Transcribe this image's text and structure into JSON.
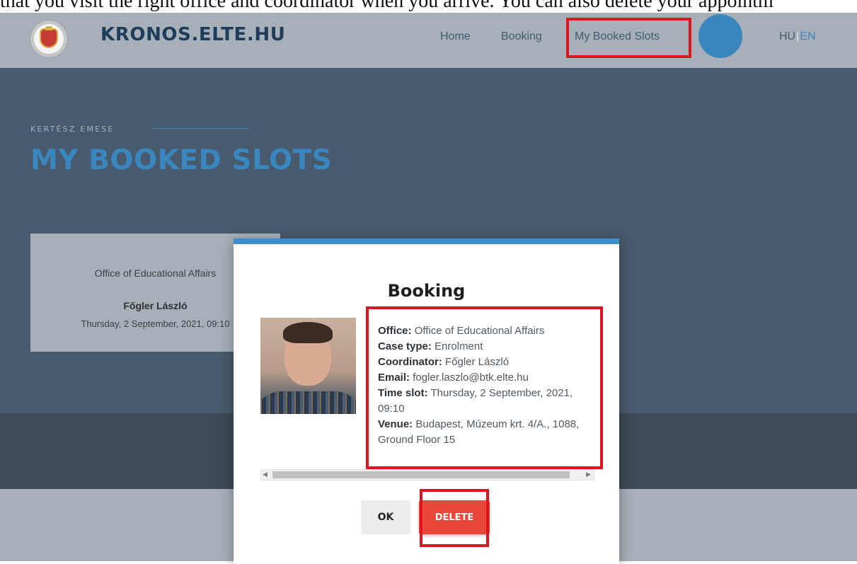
{
  "doc_text": "that you visit the right office and coordinator when you arrive. You can also delete your appointm",
  "navbar": {
    "brand": "KRONOS.ELTE.HU",
    "links": [
      "Home",
      "Booking",
      "My Booked Slots"
    ],
    "lang_hu": "HU",
    "lang_sep": "|",
    "lang_en": "EN",
    "colors": {
      "bar": "#a7afb9",
      "brand": "#1e3d5a",
      "avatar": "#3a86be"
    }
  },
  "hero": {
    "user_name": "KERTÉSZ EMESE",
    "title": "MY BOOKED SLOTS",
    "colors": {
      "background": "#485a6d",
      "title": "#3a86be"
    }
  },
  "card": {
    "office": "Office of Educational Affairs",
    "person": "Főgler László",
    "time": "Thursday, 2 September, 2021, 09:10"
  },
  "modal": {
    "title": "Booking",
    "photo_icon": "coordinator-photo",
    "details": {
      "office_label": "Office:",
      "office_value": "Office of Educational Affairs",
      "case_type_label": "Case type:",
      "case_type_value": "Enrolment",
      "coordinator_label": "Coordinator:",
      "coordinator_value": "Főgler László",
      "email_label": "Email:",
      "email_value": "fogler.laszlo@btk.elte.hu",
      "time_slot_label": "Time slot:",
      "time_slot_value": "Thursday, 2 September, 2021, 09:10",
      "venue_label": "Venue:",
      "venue_value": "Budapest, Múzeum krt. 4/A., 1088, Ground Floor 15"
    },
    "ok_label": "OK",
    "delete_label": "DELETE",
    "colors": {
      "accent": "#3b8fd0",
      "delete": "#e9473a",
      "highlight": "#e0141e"
    }
  }
}
